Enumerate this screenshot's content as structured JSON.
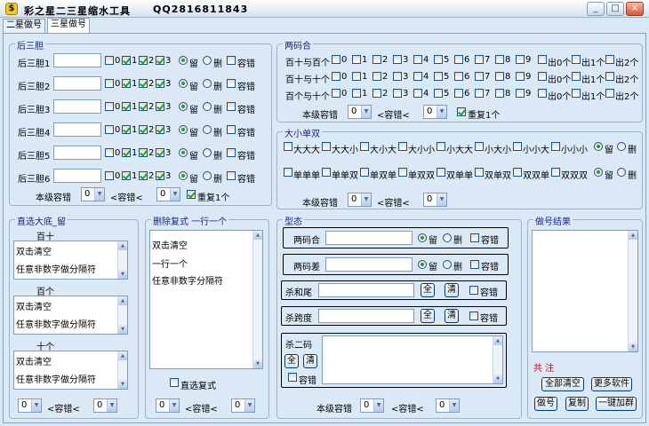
{
  "window": {
    "title": "彩之星二三星缩水工具",
    "qq": "QQ2816811843",
    "minimize": "_",
    "maximize": "□",
    "close": "×",
    "logo": "$"
  },
  "tabs": [
    "二星做号",
    "三星做号"
  ],
  "houdan": {
    "title": "后三胆",
    "rows": [
      "后三胆1",
      "后三胆2",
      "后三胆3",
      "后三胆4",
      "后三胆5",
      "后三胆6"
    ],
    "digits": [
      "0",
      "1",
      "2",
      "3"
    ],
    "checked": [
      false,
      true,
      true,
      true
    ],
    "keep": "留",
    "delete": "删",
    "tolerance": "容错",
    "level_label": "本级容错",
    "le1": "<容错<",
    "sel_a": "0",
    "sel_b": "0",
    "repeat": "重复1个"
  },
  "liangma": {
    "title": "两码合",
    "rows": [
      "百十与百个",
      "百十与十个",
      "百个与十个"
    ],
    "digits": [
      "0",
      "1",
      "2",
      "3",
      "4",
      "5",
      "6",
      "7",
      "8",
      "9"
    ],
    "extras": [
      "出0个",
      "出1个",
      "出2个"
    ],
    "level_label": "本级容错",
    "le1": "<容错<",
    "sel_a": "0",
    "sel_b": "0",
    "repeat": "重复1个"
  },
  "daxiao": {
    "title": "大小单双",
    "row1": [
      "大大大",
      "大大小",
      "大小大",
      "大小小",
      "小大大",
      "小大小",
      "小小大",
      "小小小"
    ],
    "row2": [
      "单单单",
      "单单双",
      "单双单",
      "单双双",
      "双单单",
      "双单双",
      "双双单",
      "双双双"
    ],
    "keep": "留",
    "delete": "删",
    "level_label": "本级容错",
    "le1": "<容错<",
    "sel_a": "0",
    "sel_b": "0"
  },
  "zhixuan": {
    "title": "直选大底_留",
    "sections": [
      "百十",
      "百个",
      "十个"
    ],
    "hint1": "双击清空",
    "hint2": "任意非数字做分隔符",
    "le1": "<容错<",
    "sel_a": "0",
    "sel_b": "0"
  },
  "shanchu": {
    "title": "删除复式 一行一个",
    "lines": [
      "双击清空",
      "一行一个",
      "任意非数字分隔符"
    ],
    "direct": "直选复式",
    "le1": "<容错<",
    "sel_a": "0",
    "sel_b": "0"
  },
  "xingtai": {
    "title": "型态",
    "liangmahe": "两码合",
    "liangmacha": "两码差",
    "shahewei": "杀和尾",
    "shakuadu": "杀跨度",
    "shaerma": "杀二码",
    "keep": "留",
    "delete": "删",
    "tolerance": "容错",
    "all": "全",
    "clear": "清",
    "level_label": "本级容错",
    "le1": "<容错<",
    "sel_a": "0",
    "sel_b": "0"
  },
  "result": {
    "title": "做号结果",
    "count": "共  注",
    "clear_all": "全部清空",
    "more": "更多软件",
    "make": "做号",
    "copy": "复制",
    "oneclick": "一键加群"
  }
}
